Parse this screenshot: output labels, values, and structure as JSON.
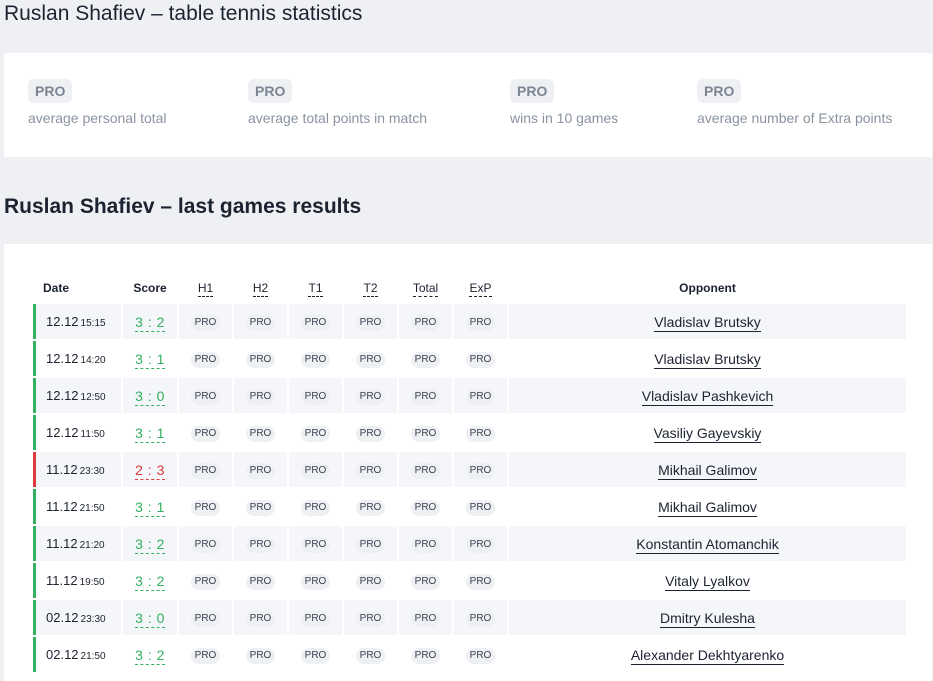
{
  "page_title": "Ruslan Shafiev – table tennis statistics",
  "stats": [
    {
      "badge": "PRO",
      "label": "average personal total"
    },
    {
      "badge": "PRO",
      "label": "average total points in match"
    },
    {
      "badge": "PRO",
      "label": "wins in 10 games"
    },
    {
      "badge": "PRO",
      "label": "average number of Extra points"
    }
  ],
  "section_title": "Ruslan Shafiev – last games results",
  "table": {
    "headers": {
      "date": "Date",
      "score": "Score",
      "h1": "H1",
      "h2": "H2",
      "t1": "T1",
      "t2": "T2",
      "total": "Total",
      "exp": "ExP",
      "opponent": "Opponent"
    },
    "pro_label": "PRO",
    "rows": [
      {
        "date": "12.12",
        "time": "15:15",
        "score": "3 : 2",
        "result": "win",
        "opponent": "Vladislav Brutsky"
      },
      {
        "date": "12.12",
        "time": "14:20",
        "score": "3 : 1",
        "result": "win",
        "opponent": "Vladislav Brutsky"
      },
      {
        "date": "12.12",
        "time": "12:50",
        "score": "3 : 0",
        "result": "win",
        "opponent": "Vladislav Pashkevich"
      },
      {
        "date": "12.12",
        "time": "11:50",
        "score": "3 : 1",
        "result": "win",
        "opponent": "Vasiliy Gayevskiy"
      },
      {
        "date": "11.12",
        "time": "23:30",
        "score": "2 : 3",
        "result": "loss",
        "opponent": "Mikhail Galimov"
      },
      {
        "date": "11.12",
        "time": "21:50",
        "score": "3 : 1",
        "result": "win",
        "opponent": "Mikhail Galimov"
      },
      {
        "date": "11.12",
        "time": "21:20",
        "score": "3 : 2",
        "result": "win",
        "opponent": "Konstantin Atomanchik"
      },
      {
        "date": "11.12",
        "time": "19:50",
        "score": "3 : 2",
        "result": "win",
        "opponent": "Vitaly Lyalkov"
      },
      {
        "date": "02.12",
        "time": "23:30",
        "score": "3 : 0",
        "result": "win",
        "opponent": "Dmitry Kulesha"
      },
      {
        "date": "02.12",
        "time": "21:50",
        "score": "3 : 2",
        "result": "win",
        "opponent": "Alexander Dekhtyarenko"
      }
    ]
  },
  "colors": {
    "win": "#33b061",
    "loss": "#dd3b3b",
    "page_bg": "#eef0f4",
    "card_bg": "#ffffff"
  }
}
